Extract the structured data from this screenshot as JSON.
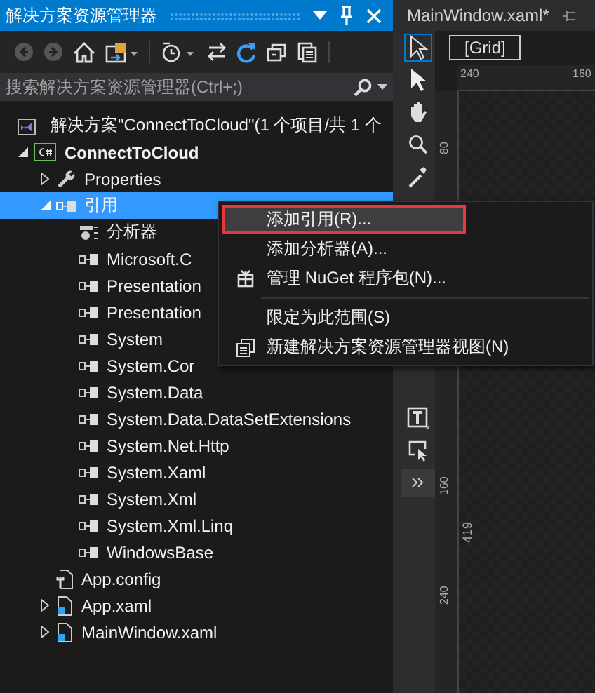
{
  "explorer": {
    "title": "解决方案资源管理器",
    "search": {
      "placeholder": "搜索解决方案资源管理器(Ctrl+;)"
    },
    "solution": {
      "label": "解决方案\"ConnectToCloud\"(1 个项目/共 1 个",
      "selected": false,
      "children": [
        {
          "kind": "project",
          "label": "ConnectToCloud",
          "expanded": true,
          "selected": false,
          "children": [
            {
              "kind": "properties",
              "label": "Properties",
              "expanded": false,
              "selected": false
            },
            {
              "kind": "references",
              "label": "引用",
              "expanded": true,
              "selected": true,
              "children": [
                {
                  "kind": "analyzer",
                  "label": "分析器",
                  "selected": false
                },
                {
                  "kind": "reference",
                  "label": "Microsoft.C",
                  "selected": false
                },
                {
                  "kind": "reference",
                  "label": "Presentation",
                  "selected": false
                },
                {
                  "kind": "reference",
                  "label": "Presentation",
                  "selected": false
                },
                {
                  "kind": "reference",
                  "label": "System",
                  "selected": false
                },
                {
                  "kind": "reference",
                  "label": "System.Cor",
                  "selected": false
                },
                {
                  "kind": "reference",
                  "label": "System.Data",
                  "selected": false
                },
                {
                  "kind": "reference",
                  "label": "System.Data.DataSetExtensions",
                  "selected": false
                },
                {
                  "kind": "reference",
                  "label": "System.Net.Http",
                  "selected": false
                },
                {
                  "kind": "reference",
                  "label": "System.Xaml",
                  "selected": false
                },
                {
                  "kind": "reference",
                  "label": "System.Xml",
                  "selected": false
                },
                {
                  "kind": "reference",
                  "label": "System.Xml.Linq",
                  "selected": false
                },
                {
                  "kind": "reference",
                  "label": "WindowsBase",
                  "selected": false
                }
              ]
            },
            {
              "kind": "config",
              "label": "App.config",
              "selected": false
            },
            {
              "kind": "xaml",
              "label": "App.xaml",
              "expanded": false,
              "selected": false
            },
            {
              "kind": "xaml",
              "label": "MainWindow.xaml",
              "expanded": false,
              "selected": false
            }
          ]
        }
      ]
    }
  },
  "context_menu": [
    {
      "kind": "plain",
      "label": "添加引用(R)...",
      "selected": true,
      "outlined": true,
      "separator_before": false
    },
    {
      "kind": "plain",
      "label": "添加分析器(A)...",
      "selected": false,
      "outlined": false,
      "separator_before": false
    },
    {
      "kind": "package",
      "label": "管理 NuGet 程序包(N)...",
      "selected": false,
      "outlined": false,
      "separator_before": false
    },
    {
      "kind": "plain",
      "label": "限定为此范围(S)",
      "selected": false,
      "outlined": false,
      "separator_before": true
    },
    {
      "kind": "views",
      "label": "新建解决方案资源管理器视图(N)",
      "selected": false,
      "outlined": false,
      "separator_before": false
    }
  ],
  "editor": {
    "tab": {
      "title": "MainWindow.xaml*"
    },
    "breadcrumb": "[Grid]",
    "tools": [
      {
        "kind": "select",
        "selected": true
      },
      {
        "kind": "pointer",
        "selected": false
      },
      {
        "kind": "pan",
        "selected": false
      },
      {
        "kind": "zoom",
        "selected": false
      },
      {
        "kind": "eyedropper",
        "selected": false
      },
      {
        "kind": "text",
        "selected": false
      },
      {
        "kind": "selection",
        "selected": false
      },
      {
        "kind": "more",
        "selected": false
      }
    ],
    "top_ruler": [
      "240",
      "160"
    ],
    "left_ruler": [
      "80",
      "160",
      "240"
    ],
    "dimension": "419"
  }
}
